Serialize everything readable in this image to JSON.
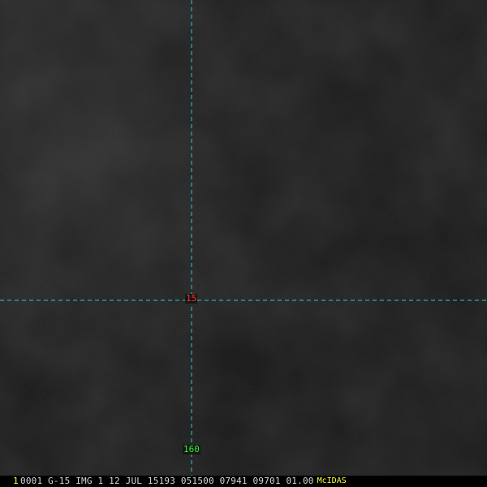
{
  "image": {
    "latitude_label": "15",
    "longitude_label": "160"
  },
  "status_bar": {
    "frame_number": "1",
    "header_text": "0001 G-15 IMG     1 12 JUL 15193 051500 07941 09701 01.00",
    "brand": "McIDAS"
  },
  "colors": {
    "background": "#171717",
    "grid_line": "#2ac8c8",
    "latitude_label": "#ff2a2a",
    "longitude_label": "#33ee33",
    "frame_number": "#ffff33",
    "brand": "#ffff33",
    "header_text": "#d8d8d8"
  }
}
